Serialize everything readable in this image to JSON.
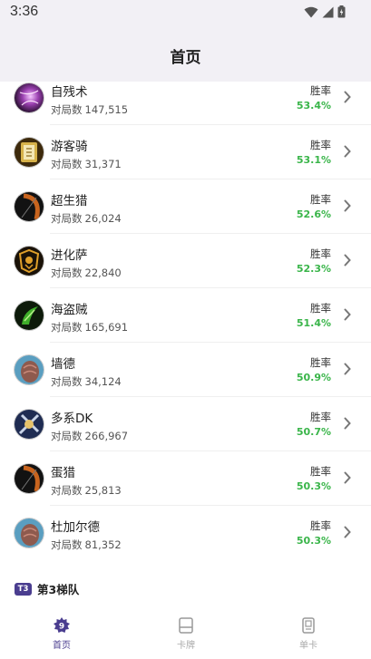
{
  "status_bar": {
    "time": "3:36"
  },
  "header": {
    "title": "首页"
  },
  "list": {
    "games_label": "对局数",
    "winrate_label": "胜率",
    "items": [
      {
        "name": "自残术",
        "games": "147,515",
        "winrate": "53.4%",
        "icon": "warlock-deck-icon"
      },
      {
        "name": "游客骑",
        "games": "31,371",
        "winrate": "53.1%",
        "icon": "paladin-deck-icon"
      },
      {
        "name": "超生猎",
        "games": "26,024",
        "winrate": "52.6%",
        "icon": "hunter-deck-icon"
      },
      {
        "name": "进化萨",
        "games": "22,840",
        "winrate": "52.3%",
        "icon": "shaman-deck-icon"
      },
      {
        "name": "海盗贼",
        "games": "165,691",
        "winrate": "51.4%",
        "icon": "rogue-deck-icon"
      },
      {
        "name": "墙德",
        "games": "34,124",
        "winrate": "50.9%",
        "icon": "druid-deck-icon"
      },
      {
        "name": "多系DK",
        "games": "266,967",
        "winrate": "50.7%",
        "icon": "death-knight-deck-icon"
      },
      {
        "name": "蛋猎",
        "games": "25,813",
        "winrate": "50.3%",
        "icon": "hunter-deck-icon"
      },
      {
        "name": "杜加尔德",
        "games": "81,352",
        "winrate": "50.3%",
        "icon": "druid-deck-icon"
      }
    ]
  },
  "tier_section": {
    "badge": "T3",
    "label": "第3梯队"
  },
  "tabbar": {
    "tabs": [
      {
        "label": "首页",
        "icon": "home-icon",
        "active": true
      },
      {
        "label": "卡牌",
        "icon": "card-icon",
        "active": false
      },
      {
        "label": "单卡",
        "icon": "single-card-icon",
        "active": false
      }
    ]
  },
  "colors": {
    "accent": "#4a3d8f",
    "winrate": "#3ab54a",
    "header_bg": "#f2f0f5"
  }
}
